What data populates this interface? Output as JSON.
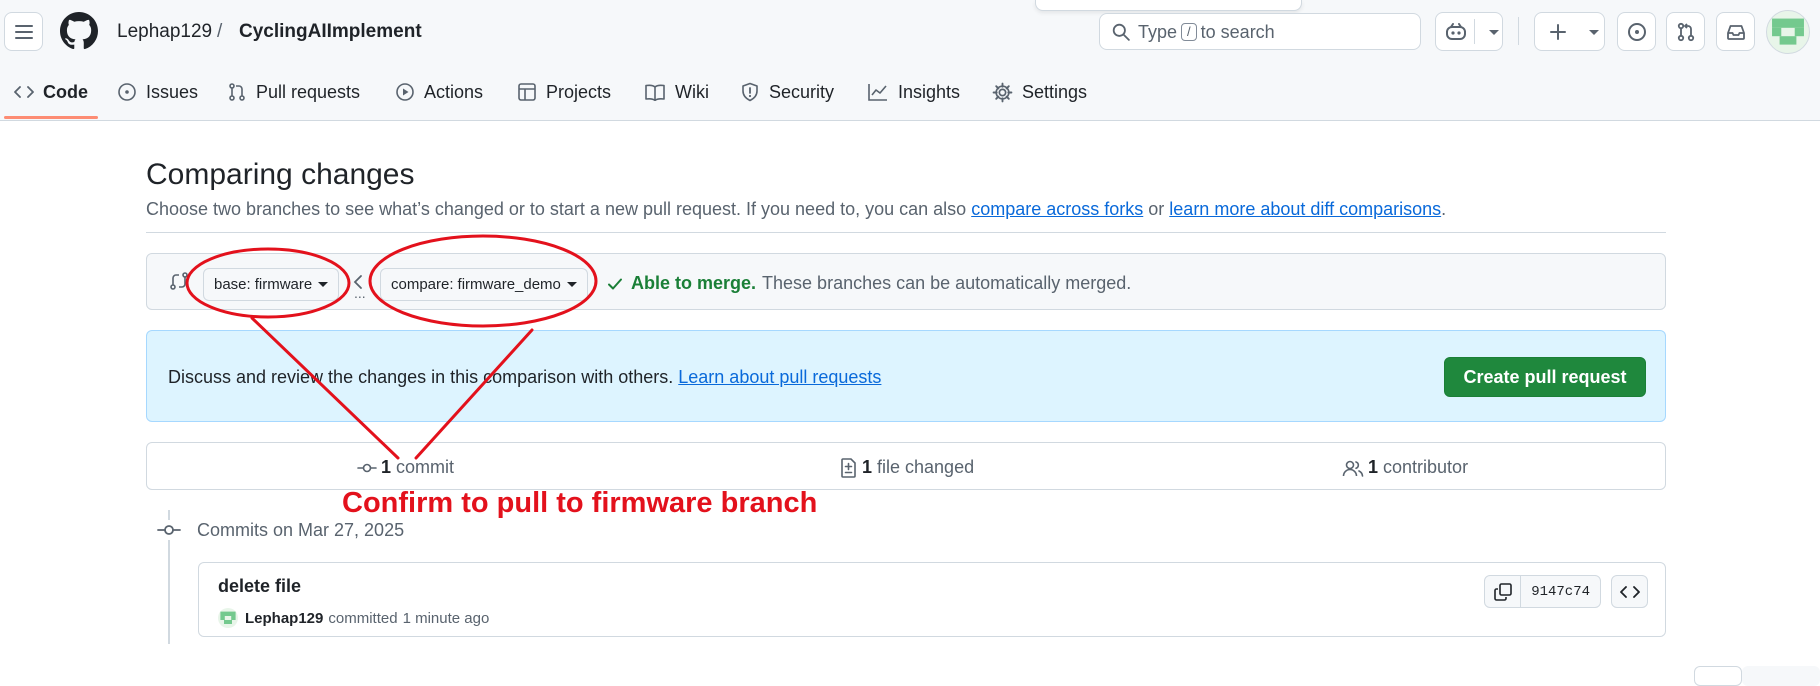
{
  "header": {
    "owner": "Lephap129",
    "separator": "/",
    "repo": "CyclingAIImplement",
    "search": {
      "placeholder_before": "Type",
      "shortcut": "/",
      "placeholder_after": "to search"
    }
  },
  "nav": {
    "tabs": [
      {
        "label": "Code",
        "icon": "code-icon",
        "selected": true
      },
      {
        "label": "Issues",
        "icon": "issue-opened-icon"
      },
      {
        "label": "Pull requests",
        "icon": "git-pull-request-icon"
      },
      {
        "label": "Actions",
        "icon": "play-icon"
      },
      {
        "label": "Projects",
        "icon": "table-icon"
      },
      {
        "label": "Wiki",
        "icon": "book-icon"
      },
      {
        "label": "Security",
        "icon": "shield-icon"
      },
      {
        "label": "Insights",
        "icon": "graph-icon"
      },
      {
        "label": "Settings",
        "icon": "gear-icon"
      }
    ]
  },
  "page": {
    "title": "Comparing changes",
    "subtitle_start": "Choose two branches to see what’s changed or to start a new pull request. If you need to, you can also",
    "link_forks": "compare across forks",
    "subtitle_or": "or",
    "link_learn": "learn more about diff comparisons",
    "subtitle_end": "."
  },
  "range": {
    "base_label": "base:",
    "base_branch": "firmware",
    "compare_label": "compare:",
    "compare_branch": "firmware_demo",
    "status_ok": "Able to merge.",
    "status_msg": "These branches can be automatically merged."
  },
  "flash": {
    "text": "Discuss and review the changes in this comparison with others.",
    "link": "Learn about pull requests",
    "button": "Create pull request"
  },
  "stats": {
    "commits_count": "1",
    "commits_label": "commit",
    "files_count": "1",
    "files_label": "file changed",
    "contributors_count": "1",
    "contributors_label": "contributor"
  },
  "commits": {
    "date_heading": "Commits on Mar 27, 2025",
    "items": [
      {
        "title": "delete file",
        "author": "Lephap129",
        "action": "committed",
        "time": "1 minute ago",
        "sha": "9147c74"
      }
    ]
  },
  "annotation": {
    "text": "Confirm to pull to firmware branch",
    "color": "#e3111c"
  },
  "colors": {
    "primary_green": "#1f883d",
    "link_blue": "#0969da",
    "flash_bg": "#ddf4ff",
    "tab_underline": "#fd8c73"
  }
}
